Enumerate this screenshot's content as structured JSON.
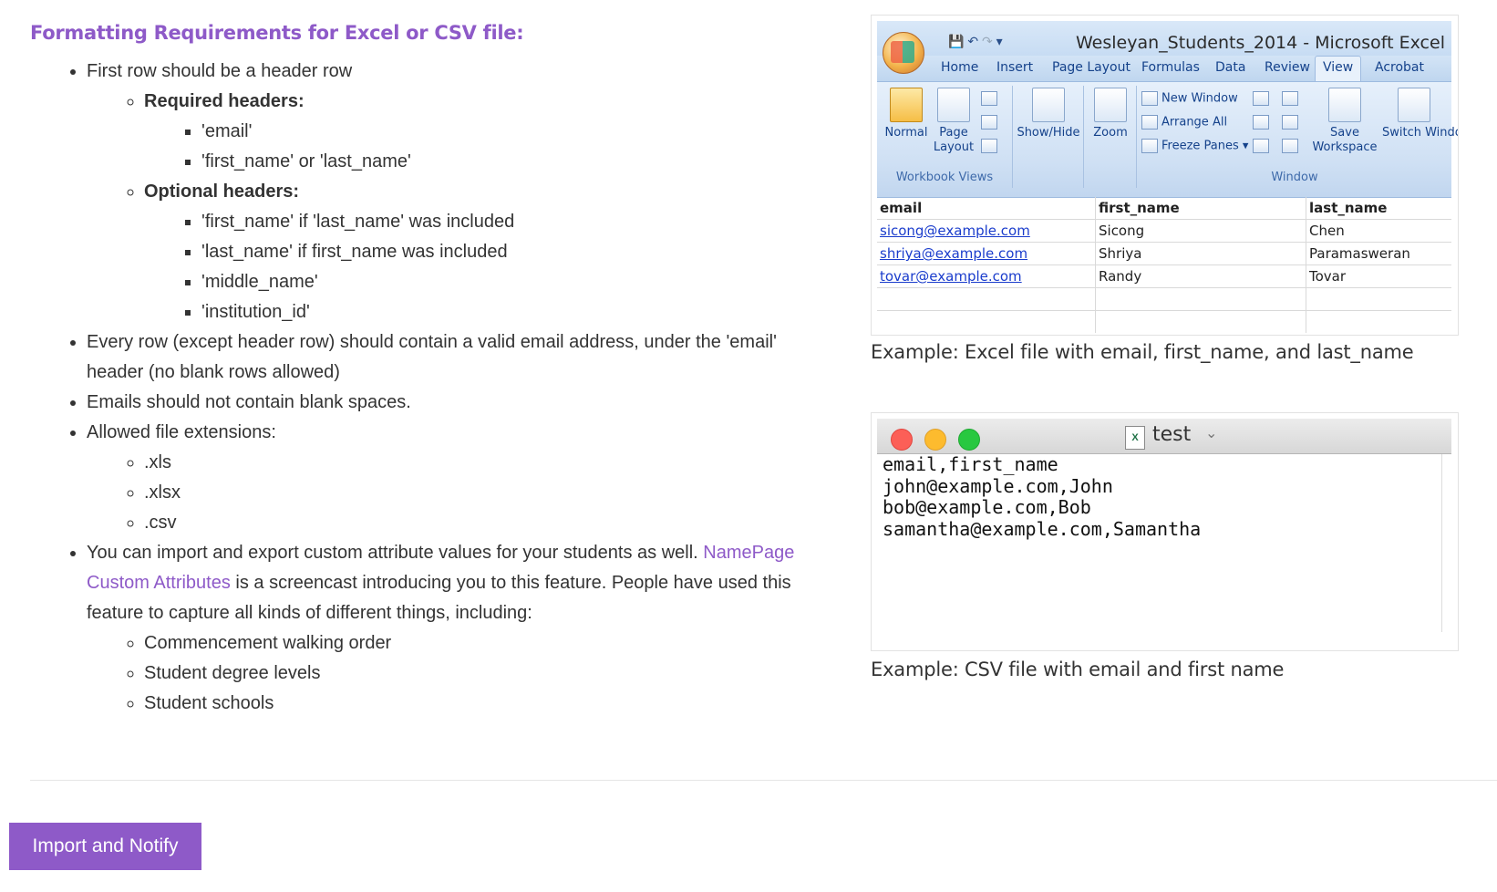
{
  "heading": "Formatting Requirements for Excel or CSV file:",
  "req_header_row": "First row should be a header row",
  "required_headers_label": "Required headers:",
  "required_headers": [
    "'email'",
    "'first_name' or 'last_name'"
  ],
  "optional_headers_label": "Optional headers:",
  "optional_headers": [
    "'first_name' if 'last_name' was included",
    "'last_name' if first_name was included",
    "'middle_name'",
    "'institution_id'"
  ],
  "req_email_row": "Every row (except header row) should contain a valid email address, under the 'email' header (no blank rows allowed)",
  "req_no_spaces": "Emails should not contain blank spaces.",
  "req_extensions": "Allowed file extensions:",
  "extensions": [
    ".xls",
    ".xlsx",
    ".csv"
  ],
  "custom_attr": {
    "before": "You can import and export custom attribute values for your students as well. ",
    "link": "NamePage Custom Attributes",
    "after": " is a screencast introducing you to this feature. People have used this feature to capture all kinds of different things, including:"
  },
  "examples": [
    "Commencement walking order",
    "Student degree levels",
    "Student schools"
  ],
  "excel": {
    "window_title": "Wesleyan_Students_2014 - Microsoft Excel",
    "tabs": [
      "Home",
      "Insert",
      "Page Layout",
      "Formulas",
      "Data",
      "Review",
      "View",
      "Acrobat"
    ],
    "btn_normal": "Normal",
    "btn_page_layout": "Page Layout",
    "btn_show_hide": "Show/Hide",
    "btn_zoom": "Zoom",
    "btn_new_window": "New Window",
    "btn_arrange_all": "Arrange All",
    "btn_freeze_panes": "Freeze Panes",
    "btn_save_workspace": "Save Workspace",
    "btn_switch_windows": "Switch Window",
    "group_workbook_views": "Workbook Views",
    "group_window": "Window",
    "headers": [
      "email",
      "first_name",
      "last_name"
    ],
    "rows": [
      [
        "sicong@example.com",
        "Sicong",
        "Chen"
      ],
      [
        "shriya@example.com",
        "Shriya",
        "Paramasweran"
      ],
      [
        "tovar@example.com",
        "Randy",
        "Tovar"
      ]
    ],
    "caption": "Example: Excel file with email, first_name, and last_name"
  },
  "csv": {
    "title": "test",
    "lines": [
      "email,first_name",
      "john@example.com,John",
      "bob@example.com,Bob",
      "samantha@example.com,Samantha"
    ],
    "caption": "Example: CSV file with email and first name"
  },
  "import_button": "Import and Notify",
  "colors": {
    "accent": "#8e5ac8",
    "text": "#333333"
  }
}
